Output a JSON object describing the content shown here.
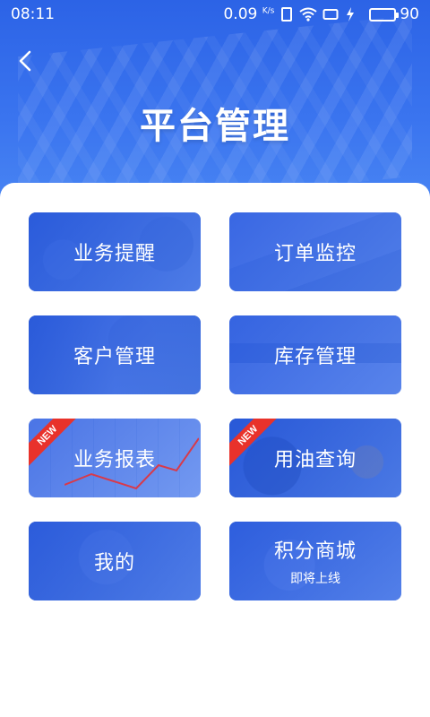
{
  "status_bar": {
    "time": "08:11",
    "speed": "0.09",
    "speed_unit": "K/s",
    "battery": "90",
    "battery_color": "#3ee35c"
  },
  "header": {
    "title": "平台管理",
    "back_icon": "chevron-left-icon",
    "bg_color": "#2c63e6"
  },
  "tiles": [
    {
      "label": "业务提醒",
      "new": false
    },
    {
      "label": "订单监控",
      "new": false
    },
    {
      "label": "客户管理",
      "new": false
    },
    {
      "label": "库存管理",
      "new": false
    },
    {
      "label": "业务报表",
      "new": true
    },
    {
      "label": "用油查询",
      "new": true
    },
    {
      "label": "我的",
      "new": false
    },
    {
      "label": "积分商城",
      "sublabel": "即将上线",
      "new": false
    }
  ],
  "badge": {
    "new_label": "NEW",
    "color": "#e8322b"
  }
}
